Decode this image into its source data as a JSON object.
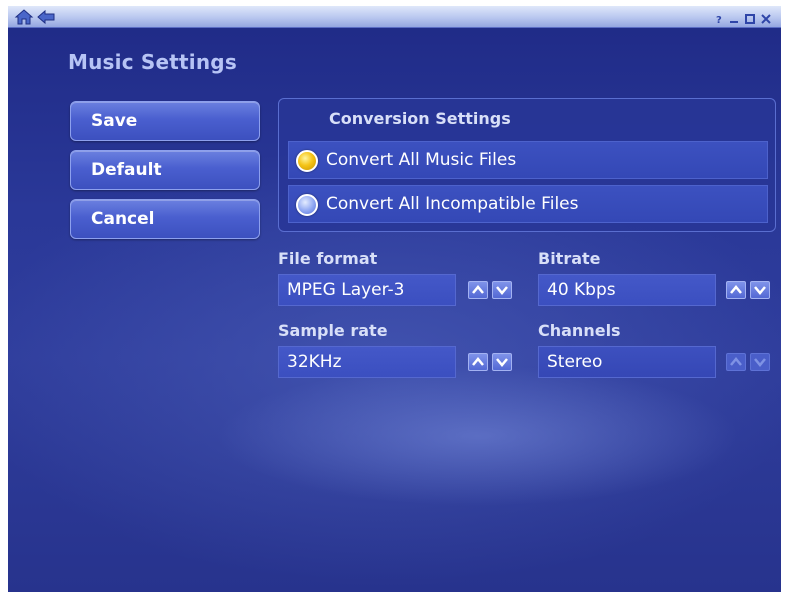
{
  "page": {
    "title": "Music Settings"
  },
  "titlebar": {
    "home_icon": "home-icon",
    "back_icon": "back-arrow-icon",
    "controls": [
      "help-icon",
      "minimize-icon",
      "maximize-icon",
      "close-icon"
    ]
  },
  "actions": {
    "save": "Save",
    "default": "Default",
    "cancel": "Cancel"
  },
  "conversion": {
    "heading": "Conversion Settings",
    "options": [
      {
        "label": "Convert All Music Files",
        "selected": true
      },
      {
        "label": "Convert All Incompatible Files",
        "selected": false
      }
    ]
  },
  "fields": {
    "file_format": {
      "label": "File format",
      "value": "MPEG Layer-3",
      "enabled": true
    },
    "bitrate": {
      "label": "Bitrate",
      "value": "40 Kbps",
      "enabled": true
    },
    "sample_rate": {
      "label": "Sample rate",
      "value": "32KHz",
      "enabled": true
    },
    "channels": {
      "label": "Channels",
      "value": "Stereo",
      "enabled": false
    }
  },
  "colors": {
    "background": "#2a3898",
    "accent_selected": "#f5c418",
    "heading_text": "#b7c4f5"
  }
}
